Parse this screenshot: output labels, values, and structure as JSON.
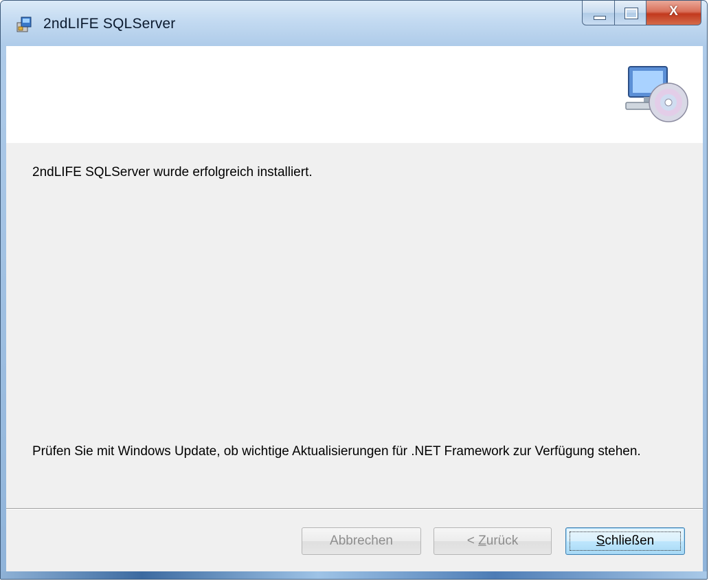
{
  "window": {
    "title": "2ndLIFE SQLServer",
    "close_glyph": "X"
  },
  "content": {
    "message_installed": "2ndLIFE SQLServer wurde erfolgreich installiert.",
    "message_update": "Prüfen Sie mit Windows Update, ob wichtige Aktualisierungen für .NET Framework zur Verfügung stehen."
  },
  "buttons": {
    "cancel": "Abbrechen",
    "back_prefix": "< ",
    "back_mnemonic": "Z",
    "back_rest": "urück",
    "close_mnemonic": "S",
    "close_rest": "chließen"
  },
  "icons": {
    "title": "installer-icon",
    "banner": "computer-cd-icon"
  },
  "colors": {
    "accent": "#3c7fb1",
    "close_button": "#c2391e"
  }
}
